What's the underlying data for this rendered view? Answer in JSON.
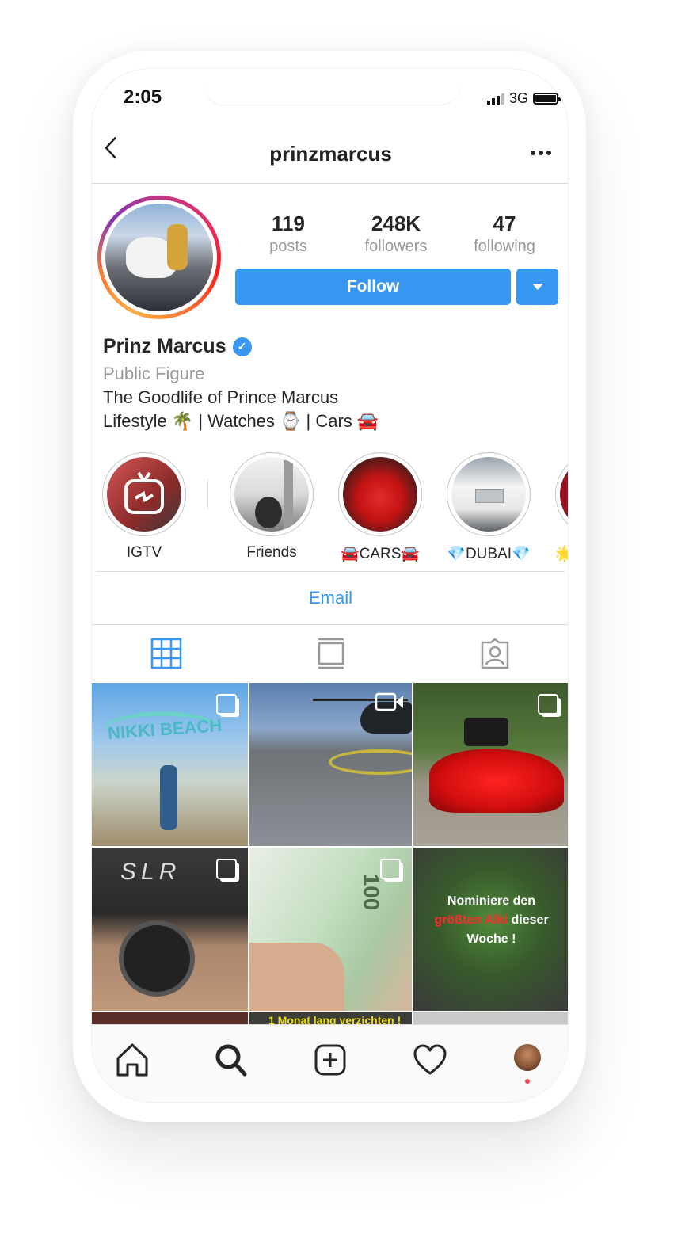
{
  "status_bar": {
    "time": "2:05",
    "network": "3G"
  },
  "header": {
    "username": "prinzmarcus",
    "back_icon": "chevron-left-icon",
    "more_icon": "ellipsis-icon"
  },
  "profile": {
    "stats": [
      {
        "value": "119",
        "label": "posts"
      },
      {
        "value": "248K",
        "label": "followers"
      },
      {
        "value": "47",
        "label": "following"
      }
    ],
    "follow_label": "Follow",
    "name": "Prinz Marcus",
    "verified": true,
    "category": "Public Figure",
    "bio_line1": "The Goodlife of Prince Marcus",
    "bio_line2": "Lifestyle 🌴 | Watches ⌚ | Cars 🚘"
  },
  "highlights": [
    {
      "label": "IGTV"
    },
    {
      "label": "Friends"
    },
    {
      "label": "🚘CARS🚘"
    },
    {
      "label": "💎DUBAI💎"
    },
    {
      "label": "🌟"
    }
  ],
  "contact": {
    "email_label": "Email"
  },
  "tabs": [
    {
      "name": "grid",
      "icon": "grid-icon",
      "active": true
    },
    {
      "name": "igtv",
      "icon": "tv-icon",
      "active": false
    },
    {
      "name": "tagged",
      "icon": "tagged-user-icon",
      "active": false
    }
  ],
  "posts": [
    {
      "desc": "beach",
      "overlay_text": "NIKKI BEACH",
      "multi": true
    },
    {
      "desc": "helicopter",
      "video": true
    },
    {
      "desc": "red car",
      "multi": true
    },
    {
      "desc": "watch",
      "overlay_text": "SLR",
      "multi": true
    },
    {
      "desc": "money",
      "overlay_text": "100",
      "multi": true
    },
    {
      "desc": "frog",
      "caption_part1": "Nominiere den",
      "caption_highlight": "größten Alki",
      "caption_part2": "dieser",
      "caption_part3": "Woche !"
    },
    {
      "desc": "partial"
    },
    {
      "desc": "partial",
      "overlay_text": "1 Monat lang verzichten !"
    },
    {
      "desc": "partial"
    }
  ],
  "bottom_nav": [
    "home-icon",
    "search-icon",
    "add-post-icon",
    "heart-icon",
    "profile-avatar"
  ],
  "colors": {
    "accent": "#3897f0",
    "verified": "#3897f0",
    "notification": "#ed4956"
  }
}
